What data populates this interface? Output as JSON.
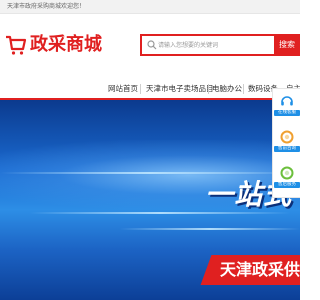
{
  "topbar": {
    "welcome": "天津市政府采购商城欢迎您！"
  },
  "logo": {
    "text": "政采商城"
  },
  "search": {
    "placeholder": "请输入您想要的关键词",
    "button": "搜索"
  },
  "nav": {
    "items": [
      {
        "label": "网站首页"
      },
      {
        "label": "天津市电子卖场品目"
      },
      {
        "label": "电脑办公"
      },
      {
        "label": "数码设备"
      },
      {
        "label": "自主创新"
      }
    ]
  },
  "banner": {
    "headline": "一站式",
    "subline": "天津政采供"
  },
  "sidebar": {
    "items": [
      {
        "label": "在线客服",
        "icon": "headset-icon"
      },
      {
        "label": "售前咨询",
        "icon": "chat-icon"
      },
      {
        "label": "售后服务",
        "icon": "service-icon"
      }
    ]
  },
  "colors": {
    "brand": "#e02020",
    "accent": "#1e8fe6",
    "banner": "#1a6ad0"
  }
}
